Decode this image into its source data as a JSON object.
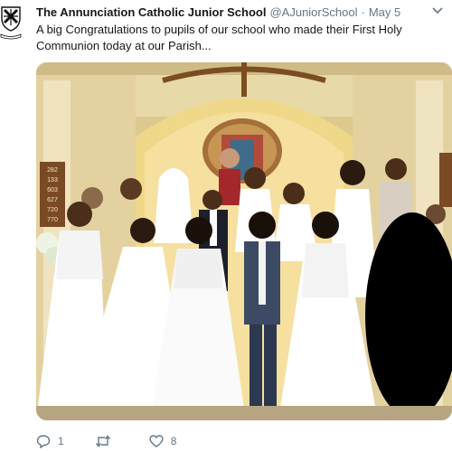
{
  "tweet": {
    "display_name": "The Annunciation Catholic Junior School",
    "handle": "@AJuniorSchool",
    "separator": "·",
    "date": "May 5",
    "text": "A big Congratulations to pupils of our school who made their First Holy Communion today at our Parish..."
  },
  "media": {
    "hymn_board_numbers": [
      "282",
      "133",
      "603",
      "627",
      "720",
      "770"
    ]
  },
  "actions": {
    "reply_count": "1",
    "retweet_count": "",
    "like_count": "8"
  },
  "icons": {
    "avatar": "school-crest-icon",
    "menu": "chevron-down-icon",
    "reply": "reply-icon",
    "retweet": "retweet-icon",
    "like": "heart-icon"
  },
  "colors": {
    "text": "#14171a",
    "muted": "#657786"
  }
}
